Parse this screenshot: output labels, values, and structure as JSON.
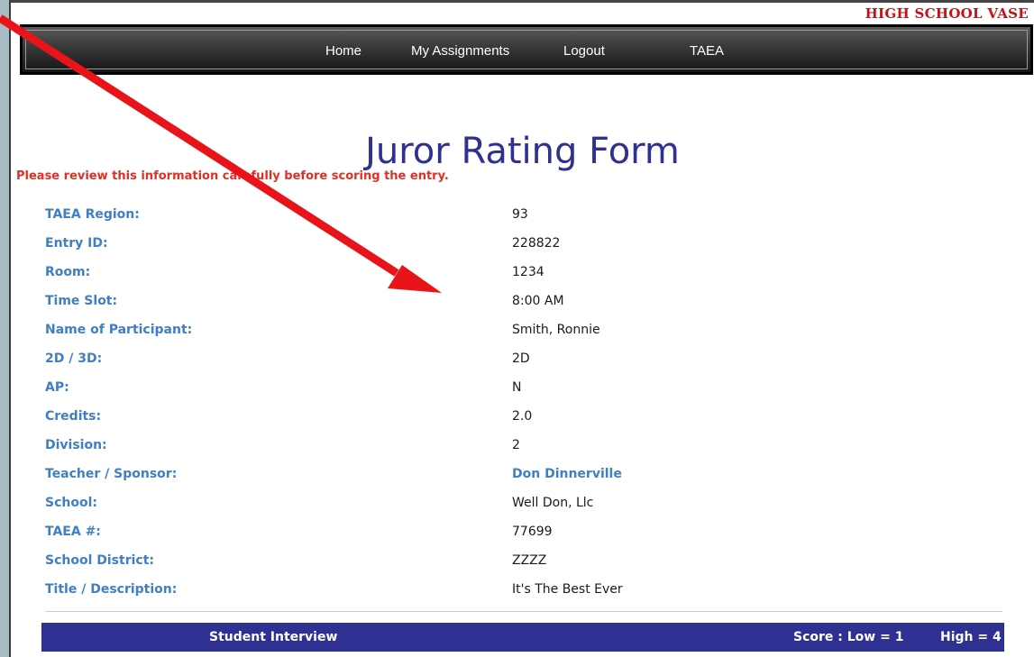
{
  "brand": "HIGH SCHOOL VASE",
  "nav": {
    "items": [
      {
        "label": "Home"
      },
      {
        "label": "My Assignments"
      },
      {
        "label": "Logout"
      },
      {
        "label": "TAEA"
      }
    ]
  },
  "page_title": "Juror Rating Form",
  "notice": "Please review this information carefully before scoring the entry.",
  "info_rows": [
    {
      "label": "TAEA Region:",
      "value": "93"
    },
    {
      "label": "Entry ID:",
      "value": "228822"
    },
    {
      "label": "Room:",
      "value": "1234"
    },
    {
      "label": "Time Slot:",
      "value": "8:00 AM"
    },
    {
      "label": "Name of Participant:",
      "value": "Smith, Ronnie"
    },
    {
      "label": "2D / 3D:",
      "value": "2D"
    },
    {
      "label": "AP:",
      "value": "N"
    },
    {
      "label": "Credits:",
      "value": "2.0"
    },
    {
      "label": "Division:",
      "value": "2"
    },
    {
      "label": "Teacher / Sponsor:",
      "value": "Don Dinnerville"
    },
    {
      "label": "School:",
      "value": "Well Don, Llc"
    },
    {
      "label": "TAEA #:",
      "value": "77699"
    },
    {
      "label": "School District:",
      "value": "ZZZZ"
    },
    {
      "label": "Title / Description:",
      "value": "It's The Best Ever"
    }
  ],
  "section": {
    "title": "Student Interview",
    "score_label": "Score : Low = 1",
    "high_label": "High = 4"
  },
  "colors": {
    "accent": "#2e3192",
    "label_blue": "#3f7fc4",
    "notice_red": "#e03024",
    "brand_red": "#c0141c",
    "arrow_red": "#e8141a"
  }
}
